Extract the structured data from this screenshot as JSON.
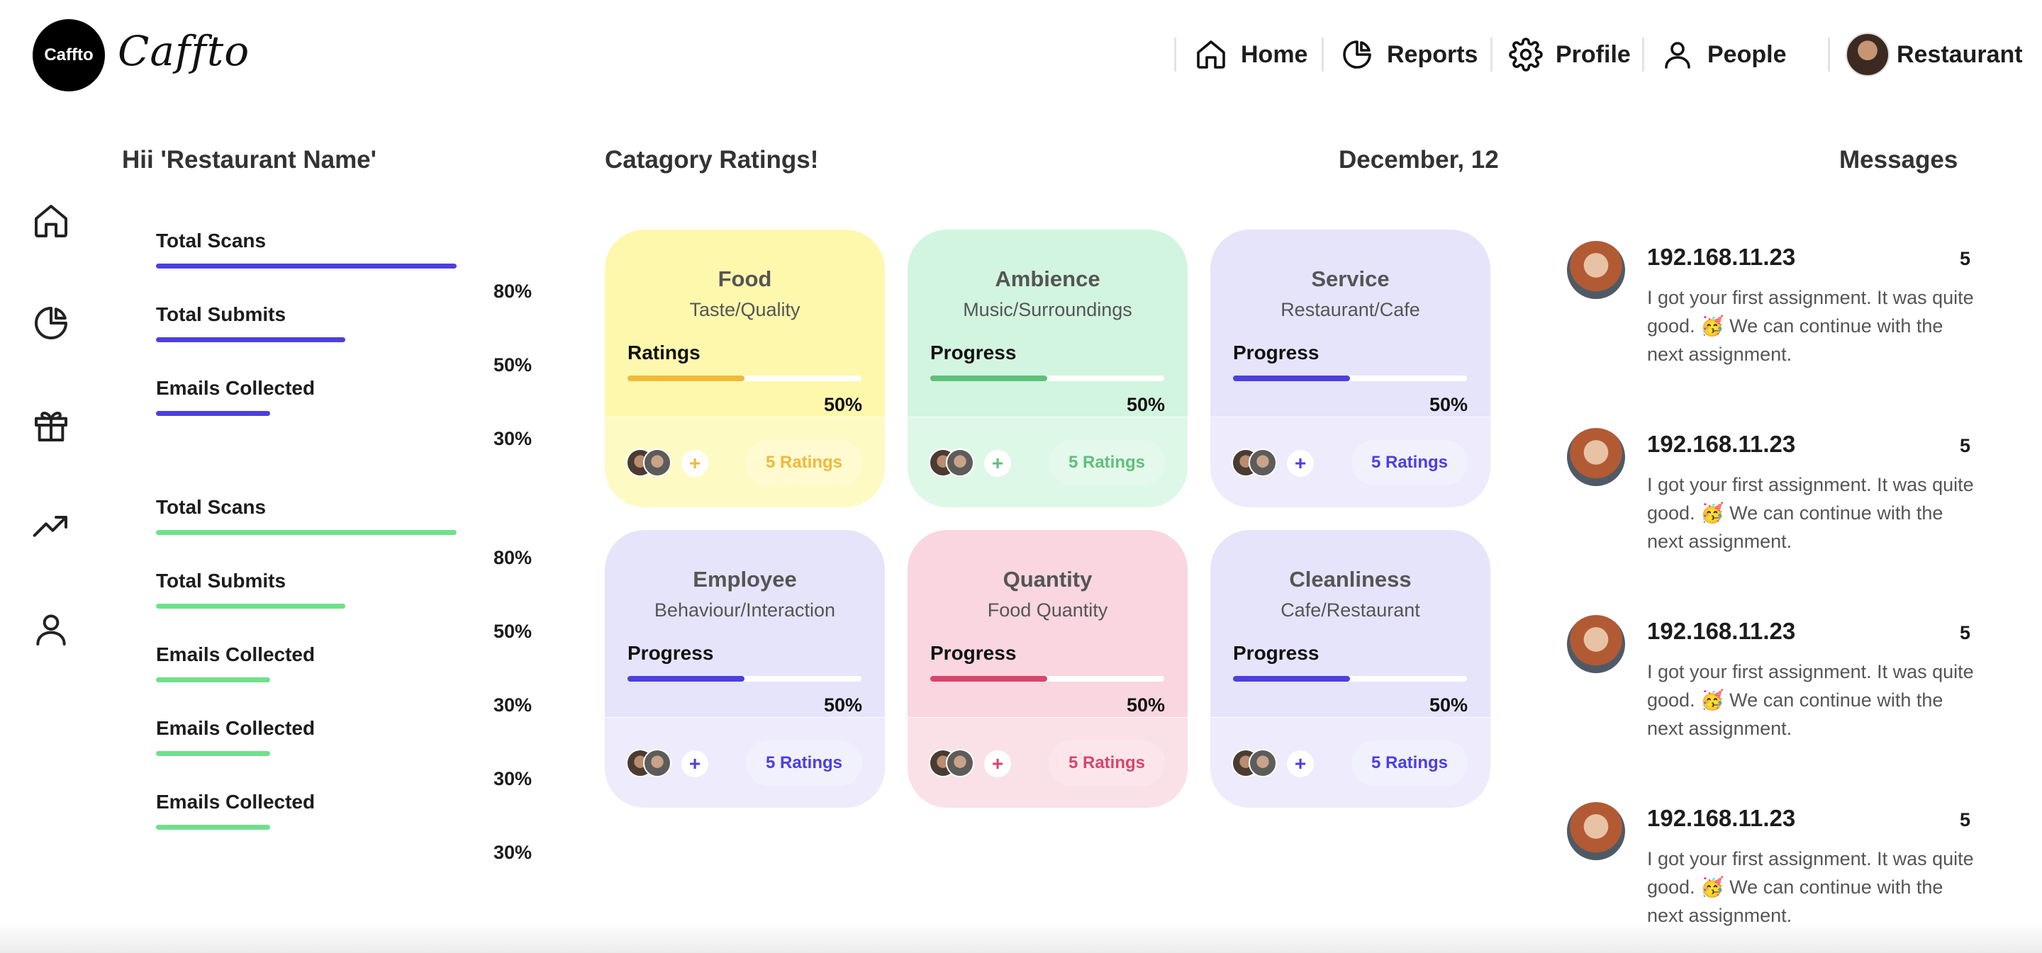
{
  "brand": {
    "logo_text": "Caffto",
    "wordmark": "Caffto"
  },
  "nav": {
    "home": "Home",
    "reports": "Reports",
    "profile": "Profile",
    "people": "People",
    "user": "Restaurant"
  },
  "rail": [
    "home-icon",
    "pie-chart-icon",
    "gift-icon",
    "trending-up-icon",
    "user-icon"
  ],
  "stats": {
    "greeting": "Hii 'Restaurant Name'",
    "group1": [
      {
        "label": "Total Scans",
        "pct": "80%",
        "value": 1.0,
        "color": "#4b3fe0"
      },
      {
        "label": "Total Submits",
        "pct": "50%",
        "value": 0.63,
        "color": "#4b3fe0"
      },
      {
        "label": "Emails Collected",
        "pct": "30%",
        "value": 0.38,
        "color": "#4b3fe0"
      }
    ],
    "group2": [
      {
        "label": "Total Scans",
        "pct": "80%",
        "value": 1.0,
        "color": "#6fe08a"
      },
      {
        "label": "Total Submits",
        "pct": "50%",
        "value": 0.63,
        "color": "#6fe08a"
      },
      {
        "label": "Emails Collected",
        "pct": "30%",
        "value": 0.38,
        "color": "#6fe08a"
      },
      {
        "label": "Emails Collected",
        "pct": "30%",
        "value": 0.38,
        "color": "#6fe08a"
      },
      {
        "label": "Emails Collected",
        "pct": "30%",
        "value": 0.38,
        "color": "#6fe08a"
      }
    ]
  },
  "categories": {
    "title": "Catagory Ratings!",
    "date": "December, 12",
    "cards": [
      {
        "title": "Food",
        "subtitle": "Taste/Quality",
        "metric": "Ratings",
        "pct": "50%",
        "progress": 0.5,
        "ratings": "5 Ratings",
        "bg": "#fef8ad",
        "accent": "#f1b93a",
        "pill_bg": "#fffad0",
        "plus": "#f1b93a"
      },
      {
        "title": "Ambience",
        "subtitle": "Music/Surroundings",
        "metric": "Progress",
        "pct": "50%",
        "progress": 0.5,
        "ratings": "5 Ratings",
        "bg": "#d2f5df",
        "accent": "#5fc07a",
        "pill_bg": "#e4f8ec",
        "plus": "#5fc07a"
      },
      {
        "title": "Service",
        "subtitle": "Restaurant/Cafe",
        "metric": "Progress",
        "pct": "50%",
        "progress": 0.5,
        "ratings": "5 Ratings",
        "bg": "#e6e4fb",
        "accent": "#4b3fe0",
        "pill_bg": "#f1f0fd",
        "plus": "#4b3fe0"
      },
      {
        "title": "Employee",
        "subtitle": "Behaviour/Interaction",
        "metric": "Progress",
        "pct": "50%",
        "progress": 0.5,
        "ratings": "5 Ratings",
        "bg": "#e6e4fb",
        "accent": "#4b3fe0",
        "pill_bg": "#f1f0fd",
        "plus": "#4b3fe0"
      },
      {
        "title": "Quantity",
        "subtitle": "Food Quantity",
        "metric": "Progress",
        "pct": "50%",
        "progress": 0.5,
        "ratings": "5 Ratings",
        "bg": "#f9d6e0",
        "accent": "#d8456c",
        "pill_bg": "#fce6ec",
        "plus": "#d8456c"
      },
      {
        "title": "Cleanliness",
        "subtitle": "Cafe/Restaurant",
        "metric": "Progress",
        "pct": "50%",
        "progress": 0.5,
        "ratings": "5 Ratings",
        "bg": "#e6e4fb",
        "accent": "#4b3fe0",
        "pill_bg": "#f1f0fd",
        "plus": "#4b3fe0"
      }
    ]
  },
  "messages": {
    "title": "Messages",
    "items": [
      {
        "from": "192.168.11.23",
        "count": "5",
        "text": "I got your first assignment. It was quite good. 🥳 We can continue with the next assignment."
      },
      {
        "from": "192.168.11.23",
        "count": "5",
        "text": "I got your first assignment. It was quite good. 🥳 We can continue with the next assignment."
      },
      {
        "from": "192.168.11.23",
        "count": "5",
        "text": "I got your first assignment. It was quite good. 🥳 We can continue with the next assignment."
      },
      {
        "from": "192.168.11.23",
        "count": "5",
        "text": "I got your first assignment. It was quite good. 🥳 We can continue with the next assignment."
      }
    ]
  }
}
